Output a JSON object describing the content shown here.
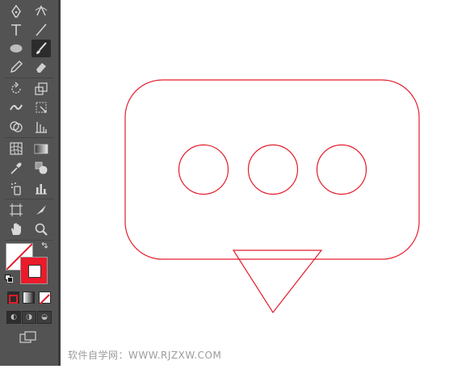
{
  "app": {
    "accent_stroke": "#e31c2c",
    "toolbar_bg": "#535353"
  },
  "toolbar": {
    "tools": [
      {
        "name": "pen-tool",
        "glyph": "✒"
      },
      {
        "name": "curvature-tool",
        "glyph": "✎"
      },
      {
        "name": "type-tool",
        "glyph": "T"
      },
      {
        "name": "line-segment-tool",
        "glyph": "╱"
      },
      {
        "name": "ellipse-tool",
        "glyph": "⬭"
      },
      {
        "name": "paintbrush-tool",
        "glyph": "🖌"
      },
      {
        "name": "pencil-tool",
        "glyph": "✏"
      },
      {
        "name": "eraser-tool",
        "glyph": "⌫"
      },
      {
        "name": "rotate-tool",
        "glyph": "⟲"
      },
      {
        "name": "scale-tool",
        "glyph": "⤢"
      },
      {
        "name": "width-tool",
        "glyph": "≋"
      },
      {
        "name": "free-transform-tool",
        "glyph": "⬚"
      },
      {
        "name": "shape-builder-tool",
        "glyph": "◔"
      },
      {
        "name": "perspective-grid-tool",
        "glyph": "▦"
      },
      {
        "name": "mesh-tool",
        "glyph": "▩"
      },
      {
        "name": "gradient-tool",
        "glyph": "▭"
      },
      {
        "name": "eyedropper-tool",
        "glyph": "⚲"
      },
      {
        "name": "blend-tool",
        "glyph": "◎"
      },
      {
        "name": "symbol-sprayer-tool",
        "glyph": "⁂"
      },
      {
        "name": "column-graph-tool",
        "glyph": "▥"
      },
      {
        "name": "artboard-tool",
        "glyph": "⊡"
      },
      {
        "name": "slice-tool",
        "glyph": "◢"
      },
      {
        "name": "hand-tool",
        "glyph": "✋"
      },
      {
        "name": "zoom-tool",
        "glyph": "⚲"
      }
    ],
    "active_tool": "paintbrush-tool"
  },
  "swatches": {
    "fill_color": "none",
    "stroke_color": "#ea1b2a",
    "swap_icon": "swap-icon",
    "default_icon": "default-colors-icon"
  },
  "color_modes": [
    "color",
    "gradient",
    "none"
  ],
  "draw_modes": [
    "draw-normal",
    "draw-behind",
    "draw-inside"
  ],
  "screen_mode_icon": "screen-mode-icon",
  "watermark": {
    "text": "软件自学网：WWW.RJZXW.COM"
  }
}
